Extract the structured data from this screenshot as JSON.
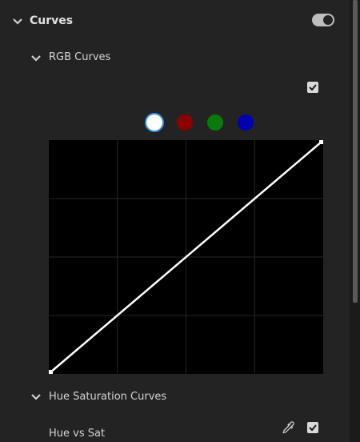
{
  "sections": {
    "curves": {
      "label": "Curves",
      "enabled": true
    },
    "rgb_curves": {
      "label": "RGB Curves",
      "checked": true
    },
    "hue_sat_curves": {
      "label": "Hue Saturation Curves"
    },
    "hue_vs_sat": {
      "label": "Hue vs Sat",
      "checked": true
    }
  },
  "channels": [
    {
      "name": "white-channel",
      "color": "#ffffff",
      "selected": true
    },
    {
      "name": "red-channel",
      "color": "#8b0000",
      "selected": false
    },
    {
      "name": "green-channel",
      "color": "#0a7a0a",
      "selected": false
    },
    {
      "name": "blue-channel",
      "color": "#0000b0",
      "selected": false
    }
  ],
  "colors": {
    "panel_bg": "#232323",
    "graph_bg": "#000000",
    "grid": "#262626",
    "curve": "#ffffff",
    "selected_ring": "#3d8ee0"
  },
  "icons": {
    "expand": "chevron-down-icon",
    "toggle": "toggle-switch-icon",
    "checkbox": "checkmark-icon",
    "eyedropper": "eyedropper-icon"
  }
}
